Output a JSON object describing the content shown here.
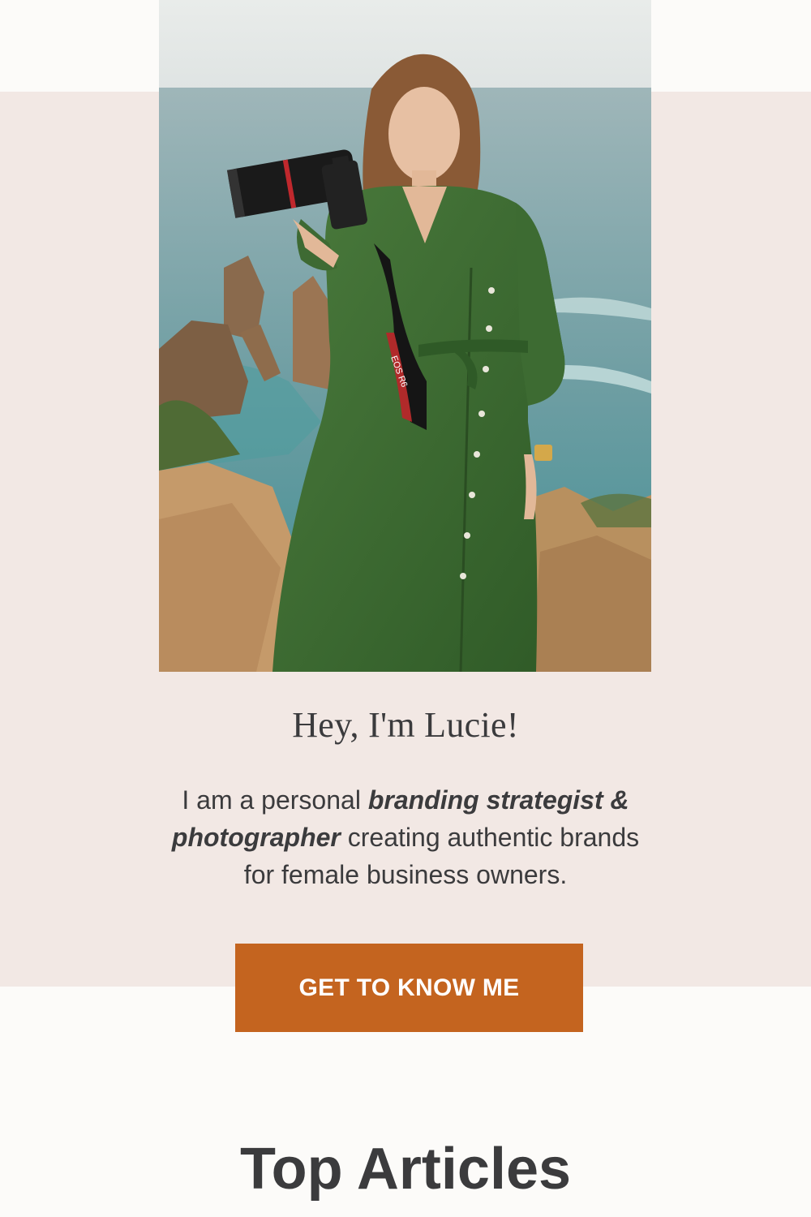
{
  "hero": {
    "image_alt": "Lucie in a green dress holding a camera on a seaside cliff",
    "camera_strap_text": "EOS R6"
  },
  "intro": {
    "greeting": "Hey, I'm Lucie!",
    "bio_part1": "I am a personal ",
    "bio_emphasis": "branding strategist & photographer",
    "bio_part2": " creating authentic brands for female business owners."
  },
  "cta": {
    "label": "GET TO KNOW ME"
  },
  "articles": {
    "title": "Top Articles"
  },
  "colors": {
    "band": "#f2e8e4",
    "page": "#fcfbf9",
    "cta": "#c4641f",
    "text": "#3b3b3d"
  }
}
